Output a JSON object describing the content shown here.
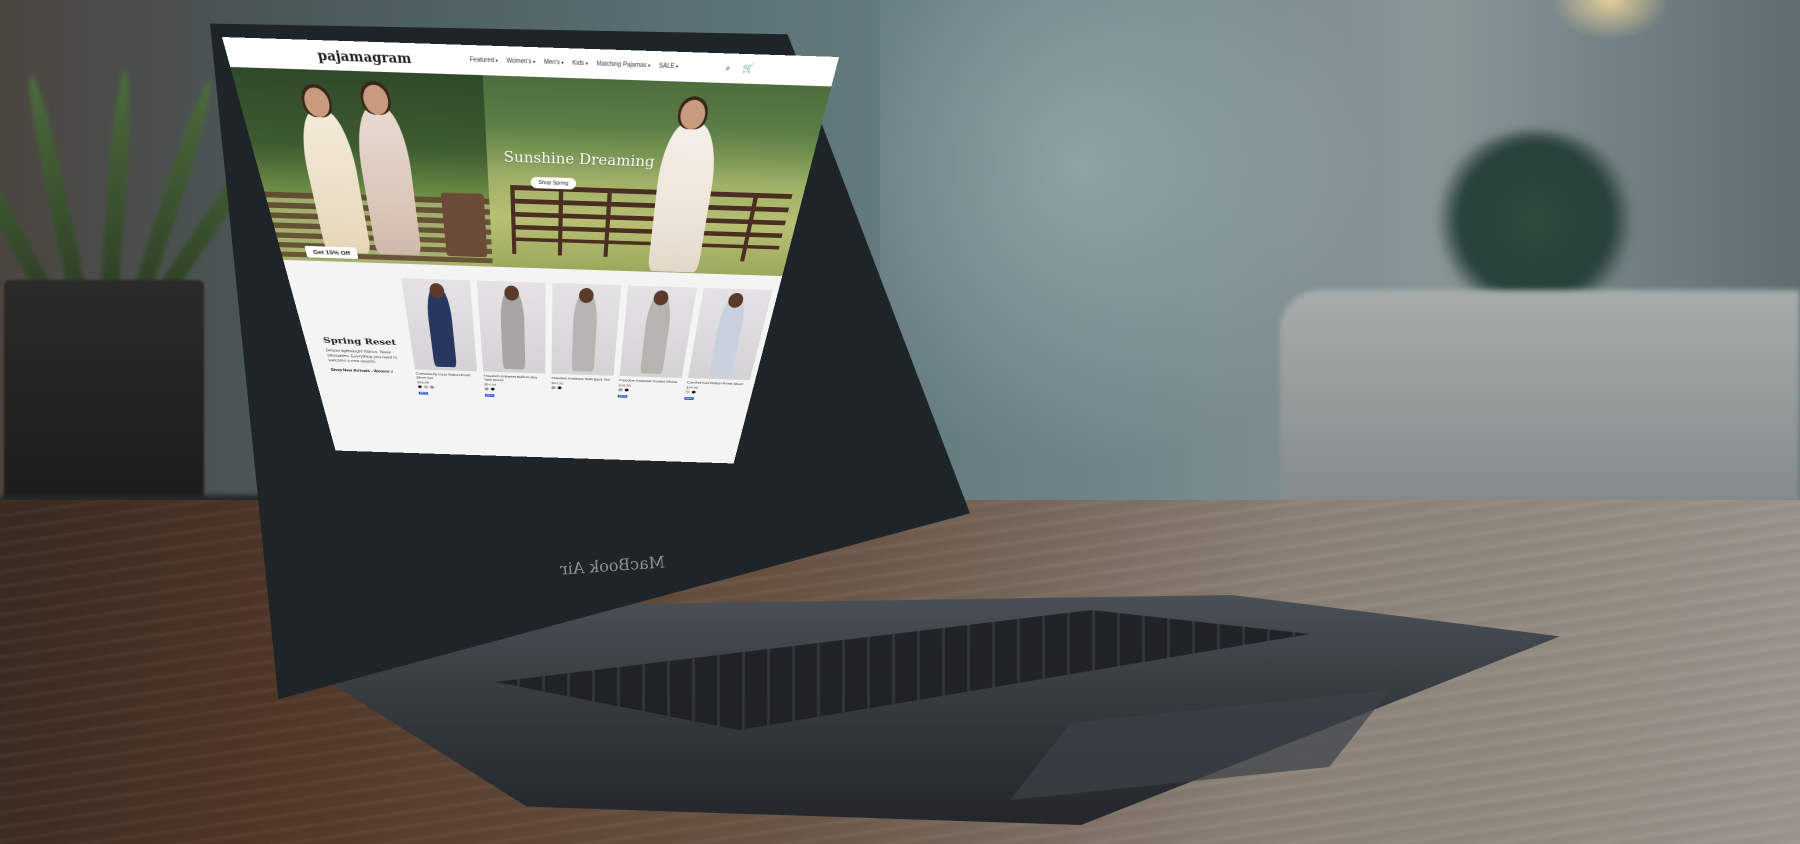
{
  "site": {
    "logo": "pajamagram",
    "menu": [
      {
        "label": "Featured"
      },
      {
        "label": "Women's"
      },
      {
        "label": "Men's"
      },
      {
        "label": "Kids"
      },
      {
        "label": "Matching Pajamas"
      },
      {
        "label": "SALE"
      }
    ]
  },
  "hero": {
    "title": "Sunshine Dreaming",
    "button": "Shop Spring",
    "promo": "Get 15% Off"
  },
  "section": {
    "title": "Spring Reset",
    "text": "Deluxe lightweight fabrics. Sleek silhouettes. Everything you need to welcome a new season.",
    "link": "Shop New Arrivals - Women >"
  },
  "products": [
    {
      "name": "Consciously Cozy Button-Front Short Set",
      "price": "$69.99",
      "badge": "NEW",
      "color": "#28375e",
      "swatches": [
        "#222222",
        "#c9a8c8",
        "#7a8fb5"
      ]
    },
    {
      "name": "Freedom Knitwear Built-In-Bra Tank Dress",
      "price": "$64.99",
      "badge": "NEW",
      "color": "#a7a6a4",
      "swatches": [
        "#999999",
        "#111111"
      ]
    },
    {
      "name": "Freedom Knitwear Split Back Tee",
      "price": "$49.99",
      "badge": "",
      "color": "#b7b5b2",
      "swatches": [
        "#999999",
        "#111111"
      ]
    },
    {
      "name": "Freedom Knitwear Pocket Shorts",
      "price": "$39.99",
      "badge": "NEW",
      "color": "#b6b4b1",
      "swatches": [
        "#999999",
        "#111111"
      ]
    },
    {
      "name": "Comfort Knit Button-Front Short",
      "price": "$49.99",
      "badge": "NEW",
      "color": "#c9d1df",
      "swatches": [
        "#cccccc",
        "#111111"
      ]
    }
  ],
  "laptop": {
    "brand": "MacBook Air"
  }
}
